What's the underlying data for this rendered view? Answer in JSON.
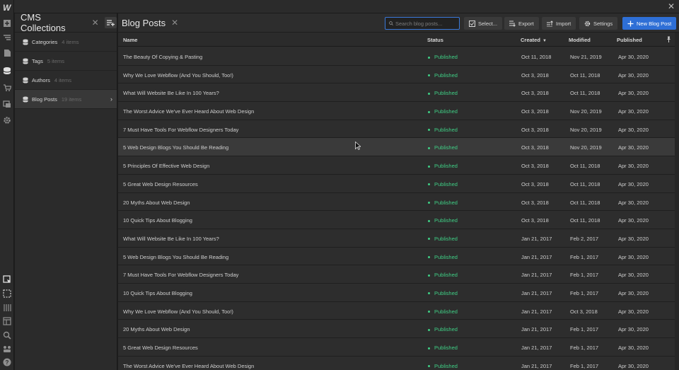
{
  "app": {
    "logo": "W",
    "rail_icons": [
      "add-icon",
      "navigator-icon",
      "pages-icon",
      "cms-icon",
      "ecommerce-icon",
      "assets-icon",
      "settings-icon",
      "select-icon",
      "audit-icon",
      "grid-icon",
      "layout-icon",
      "search-icon",
      "users-icon",
      "help-icon"
    ]
  },
  "collections": {
    "title": "CMS Collections",
    "items": [
      {
        "label": "Categories",
        "count": "4 items"
      },
      {
        "label": "Tags",
        "count": "5 items"
      },
      {
        "label": "Authors",
        "count": "4 items"
      },
      {
        "label": "Blog Posts",
        "count": "19 items",
        "active": true
      }
    ]
  },
  "main": {
    "title": "Blog Posts",
    "search_placeholder": "Search blog posts...",
    "buttons": {
      "select": "Select...",
      "export": "Export",
      "import": "Import",
      "settings": "Settings",
      "new": "New Blog Post"
    },
    "columns": {
      "name": "Name",
      "status": "Status",
      "created": "Created",
      "modified": "Modified",
      "published": "Published"
    },
    "rows": [
      {
        "name": "The Beauty Of Copying & Pasting",
        "status": "Published",
        "created": "Oct 11, 2018",
        "modified": "Nov 21, 2019",
        "published": "Apr 30, 2020"
      },
      {
        "name": "Why We Love Webflow (And You Should, Too!)",
        "status": "Published",
        "created": "Oct 3, 2018",
        "modified": "Oct 11, 2018",
        "published": "Apr 30, 2020"
      },
      {
        "name": "What Will Website Be Like In 100 Years?",
        "status": "Published",
        "created": "Oct 3, 2018",
        "modified": "Oct 11, 2018",
        "published": "Apr 30, 2020"
      },
      {
        "name": "The Worst Advice We've Ever Heard About Web Design",
        "status": "Published",
        "created": "Oct 3, 2018",
        "modified": "Nov 20, 2019",
        "published": "Apr 30, 2020"
      },
      {
        "name": "7 Must Have Tools For Webflow Designers Today",
        "status": "Published",
        "created": "Oct 3, 2018",
        "modified": "Nov 20, 2019",
        "published": "Apr 30, 2020"
      },
      {
        "name": "5 Web Design Blogs You Should Be Reading",
        "status": "Published",
        "created": "Oct 3, 2018",
        "modified": "Nov 20, 2019",
        "published": "Apr 30, 2020",
        "hover": true
      },
      {
        "name": "5 Principles Of Effective Web Design",
        "status": "Published",
        "created": "Oct 3, 2018",
        "modified": "Oct 11, 2018",
        "published": "Apr 30, 2020"
      },
      {
        "name": "5 Great Web Design Resources",
        "status": "Published",
        "created": "Oct 3, 2018",
        "modified": "Oct 11, 2018",
        "published": "Apr 30, 2020"
      },
      {
        "name": "20 Myths About Web Design",
        "status": "Published",
        "created": "Oct 3, 2018",
        "modified": "Oct 11, 2018",
        "published": "Apr 30, 2020"
      },
      {
        "name": "10 Quick Tips About Blogging",
        "status": "Published",
        "created": "Oct 3, 2018",
        "modified": "Oct 11, 2018",
        "published": "Apr 30, 2020"
      },
      {
        "name": "What Will Website Be Like In 100 Years?",
        "status": "Published",
        "created": "Jan 21, 2017",
        "modified": "Feb 2, 2017",
        "published": "Apr 30, 2020"
      },
      {
        "name": "5 Web Design Blogs You Should Be Reading",
        "status": "Published",
        "created": "Jan 21, 2017",
        "modified": "Feb 1, 2017",
        "published": "Apr 30, 2020"
      },
      {
        "name": "7 Must Have Tools For Webflow Designers Today",
        "status": "Published",
        "created": "Jan 21, 2017",
        "modified": "Feb 1, 2017",
        "published": "Apr 30, 2020"
      },
      {
        "name": "10 Quick Tips About Blogging",
        "status": "Published",
        "created": "Jan 21, 2017",
        "modified": "Feb 1, 2017",
        "published": "Apr 30, 2020"
      },
      {
        "name": "Why We Love Webflow (And You Should, Too!)",
        "status": "Published",
        "created": "Jan 21, 2017",
        "modified": "Oct 3, 2018",
        "published": "Apr 30, 2020"
      },
      {
        "name": "20 Myths About Web Design",
        "status": "Published",
        "created": "Jan 21, 2017",
        "modified": "Feb 1, 2017",
        "published": "Apr 30, 2020"
      },
      {
        "name": "5 Great Web Design Resources",
        "status": "Published",
        "created": "Jan 21, 2017",
        "modified": "Feb 1, 2017",
        "published": "Apr 30, 2020"
      },
      {
        "name": "The Worst Advice We've Ever Heard About Web Design",
        "status": "Published",
        "created": "Jan 21, 2017",
        "modified": "Feb 1, 2017",
        "published": "Apr 30, 2020"
      }
    ]
  },
  "colors": {
    "accent": "#2e6fd6",
    "published": "#3fcf85",
    "panel": "#2b2b2b"
  }
}
